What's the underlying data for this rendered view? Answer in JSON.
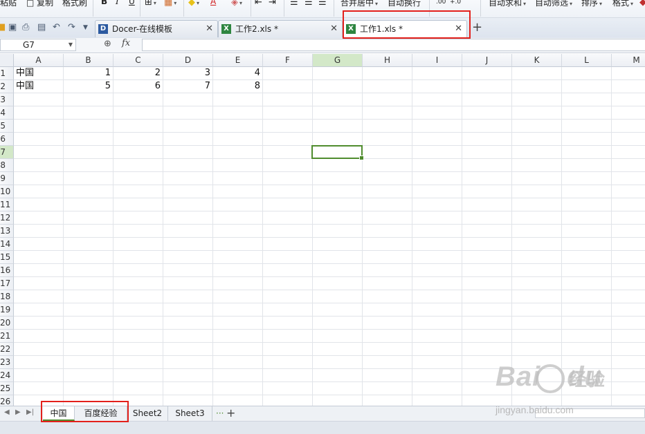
{
  "ribbon": {
    "paste": "粘贴",
    "copy": "复制",
    "format_painter": "格式刷",
    "bold": "B",
    "italic": "I",
    "underline": "U",
    "font_color": "A",
    "merge_center": "合并居中",
    "wrap_text": "自动换行",
    "decimal_a": ".00",
    "decimal_b": "+.0",
    "autosum": "自动求和",
    "autofilter": "自动筛选",
    "sort": "排序",
    "format": "格式"
  },
  "tabs": [
    {
      "label": "Docer-在线模板",
      "icon": "D",
      "color": "#2c5aa0"
    },
    {
      "label": "工作2.xls *",
      "icon": "X",
      "color": "#2e8540"
    },
    {
      "label": "工作1.xls *",
      "icon": "X",
      "color": "#2e8540"
    }
  ],
  "formula_bar": {
    "name_box": "G7",
    "fx": "fx",
    "formula": ""
  },
  "columns": [
    "A",
    "B",
    "C",
    "D",
    "E",
    "F",
    "G",
    "H",
    "I",
    "J",
    "K",
    "L",
    "M"
  ],
  "rows": [
    "1",
    "2",
    "3",
    "4",
    "5",
    "6",
    "7",
    "8",
    "9",
    "10",
    "11",
    "12",
    "13",
    "14",
    "15",
    "16",
    "17",
    "18",
    "19",
    "20",
    "21",
    "22",
    "23",
    "24",
    "25",
    "26"
  ],
  "selected_cell": {
    "column": "G",
    "row": "7"
  },
  "cells": {
    "A1": "中国",
    "B1": "1",
    "C1": "2",
    "D1": "3",
    "E1": "4",
    "A2": "中国",
    "B2": "5",
    "C2": "6",
    "D2": "7",
    "E2": "8"
  },
  "sheets": [
    "中国",
    "百度经验",
    "Sheet2",
    "Sheet3"
  ],
  "active_sheet": "中国",
  "more_sheets": "···",
  "add_sheet": "+",
  "watermark": {
    "brand": "Bai",
    "brand_end": "du",
    "cn": "经验",
    "url": "jingyan.baidu.com"
  },
  "highlight_color": "#e3201b",
  "accent_color": "#4f8c2e"
}
